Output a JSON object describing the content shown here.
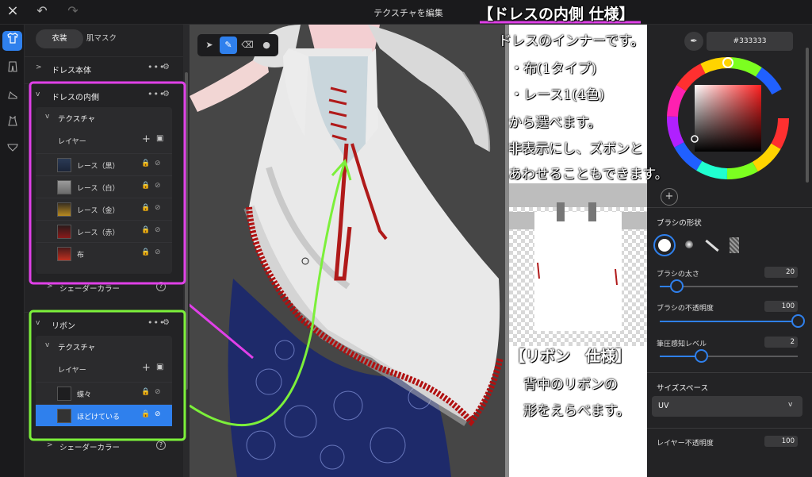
{
  "topbar": {
    "title": "テクスチャを編集",
    "close_icon": "×",
    "undo_icon": "↶",
    "redo_icon": "↷"
  },
  "rail": {
    "items": [
      "shirt-icon",
      "pants-icon",
      "shoe-icon",
      "dress-icon",
      "underwear-icon"
    ]
  },
  "left": {
    "tabs": [
      "衣装",
      "肌マスク"
    ],
    "sections": [
      {
        "label": "ドレス本体"
      },
      {
        "label": "ドレスの内側"
      },
      {
        "label": "リボン"
      }
    ],
    "texture_label": "テクスチャ",
    "layer_label": "レイヤー",
    "shader_label": "シェーダーカラー",
    "inner_layers": [
      {
        "name": "レース（黒）"
      },
      {
        "name": "レース（白）"
      },
      {
        "name": "レース（金）"
      },
      {
        "name": "レース（赤）"
      },
      {
        "name": "布"
      }
    ],
    "ribbon_layers": [
      {
        "name": "蝶々"
      },
      {
        "name": "ほどけている"
      }
    ]
  },
  "right": {
    "hex": "#333333",
    "brush_shape": "ブラシの形状",
    "brush_size": {
      "label": "ブラシの太さ",
      "value": "20",
      "level": 0.12
    },
    "brush_opacity": {
      "label": "ブラシの不透明度",
      "value": "100",
      "level": 1.0
    },
    "pressure": {
      "label": "筆圧感知レベル",
      "value": "2",
      "level": 0.3
    },
    "size_space": {
      "label": "サイズスペース",
      "value": "UV"
    },
    "layer_opacity": {
      "label": "レイヤー不透明度",
      "value": "100"
    }
  },
  "annotations": {
    "inner_title": "【ドレスの内側 仕様】",
    "inner_lines": [
      "ドレスのインナーです。",
      "・布(1タイプ)",
      "・レース1(4色)",
      "から選べます。",
      "非表示にし、ズボンと",
      "あわせることもできます。"
    ],
    "ribbon_title": "【リボン　仕様】",
    "ribbon_lines": [
      "背中のリボンの",
      "形をえらべます。"
    ]
  },
  "colors": {
    "accent": "#2f80ed",
    "pink_annotation": "#e040e8",
    "green_annotation": "#7cf03a"
  }
}
